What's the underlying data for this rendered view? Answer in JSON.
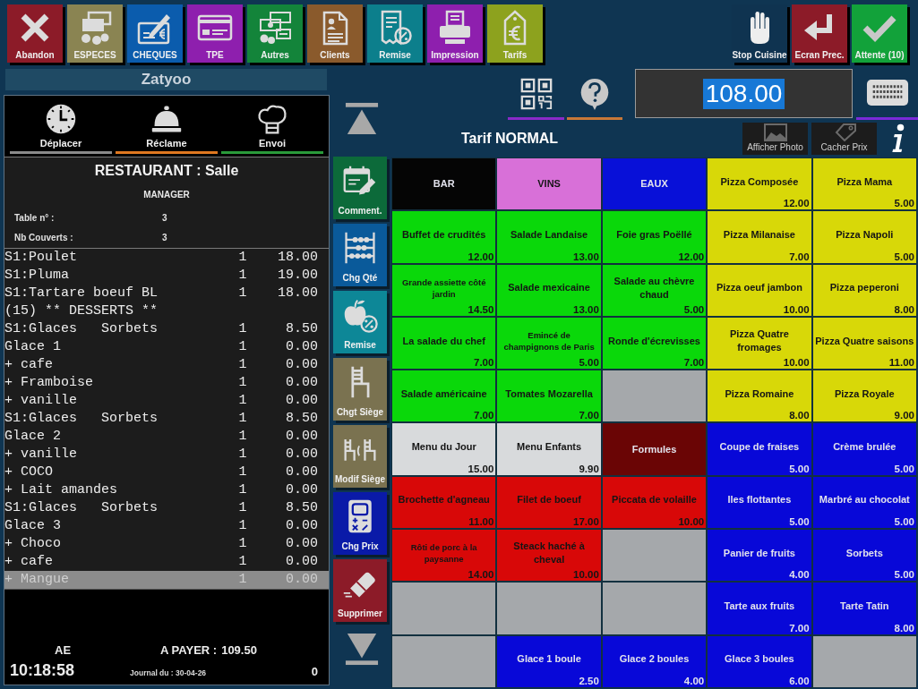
{
  "toolbar": {
    "buttons": [
      {
        "label": "Abandon",
        "color": "#8c1b28"
      },
      {
        "label": "ESPECES",
        "color": "#8a8452"
      },
      {
        "label": "CHEQUES",
        "color": "#0b5cad"
      },
      {
        "label": "TPE",
        "color": "#8e1fae"
      },
      {
        "label": "Autres",
        "color": "#13843a"
      },
      {
        "label": "Clients",
        "color": "#8a5a2c"
      },
      {
        "label": "Remise",
        "color": "#0c7f8c"
      },
      {
        "label": "Impression",
        "color": "#8e1fae"
      },
      {
        "label": "Tarifs",
        "color": "#8da21e"
      }
    ],
    "right_buttons": [
      {
        "label": "Stop Cuisine",
        "color": "#0f3350"
      },
      {
        "label": "Ecran Prec.",
        "color": "#8c1b28"
      },
      {
        "label": "Attente (10)",
        "color": "#12a23a"
      }
    ]
  },
  "ticket": {
    "title": "Zatyoo",
    "actions": [
      {
        "label": "Déplacer",
        "color": "#8a8a8a"
      },
      {
        "label": "Réclame",
        "color": "#e07820"
      },
      {
        "label": "Envoi",
        "color": "#2a9a3a"
      }
    ],
    "header": {
      "location": "RESTAURANT : Salle",
      "user": "MANAGER",
      "fields": [
        {
          "label": "Table n° :",
          "value": "3"
        },
        {
          "label": "Nb Couverts :",
          "value": "3"
        }
      ]
    },
    "lines": [
      {
        "name": "S1:Poulet",
        "qty": "1",
        "price": "18.00",
        "selected": false
      },
      {
        "name": "S1:Pluma",
        "qty": "1",
        "price": "19.00",
        "selected": false
      },
      {
        "name": "S1:Tartare boeuf BL",
        "qty": "1",
        "price": "18.00",
        "selected": false
      },
      {
        "name": "(15) ** DESSERTS **",
        "selected": false
      },
      {
        "name": "S1:Glaces   Sorbets",
        "qty": "1",
        "price": "8.50",
        "selected": false
      },
      {
        "name": "Glace 1",
        "qty": "1",
        "price": "0.00",
        "selected": false
      },
      {
        "name": "+ cafe",
        "qty": "1",
        "price": "0.00",
        "selected": false
      },
      {
        "name": "+ Framboise",
        "qty": "1",
        "price": "0.00",
        "selected": false
      },
      {
        "name": "+ vanille",
        "qty": "1",
        "price": "0.00",
        "selected": false
      },
      {
        "name": "S1:Glaces   Sorbets",
        "qty": "1",
        "price": "8.50",
        "selected": false
      },
      {
        "name": "Glace 2",
        "qty": "1",
        "price": "0.00",
        "selected": false
      },
      {
        "name": "+ vanille",
        "qty": "1",
        "price": "0.00",
        "selected": false
      },
      {
        "name": "+ COCO",
        "qty": "1",
        "price": "0.00",
        "selected": false
      },
      {
        "name": "+ Lait amandes",
        "qty": "1",
        "price": "0.00",
        "selected": false
      },
      {
        "name": "S1:Glaces   Sorbets",
        "qty": "1",
        "price": "8.50",
        "selected": false
      },
      {
        "name": "Glace 3",
        "qty": "1",
        "price": "0.00",
        "selected": false
      },
      {
        "name": "+ Choco",
        "qty": "1",
        "price": "0.00",
        "selected": false
      },
      {
        "name": "+ cafe",
        "qty": "1",
        "price": "0.00",
        "selected": false
      },
      {
        "name": "+ Mangue",
        "qty": "1",
        "price": "0.00",
        "selected": true
      }
    ],
    "footer": {
      "server": "AE",
      "amount_due": {
        "label": "A PAYER :",
        "value": "109.50"
      },
      "time": "10:18:58",
      "journal": "Journal du : 30-04-26",
      "counter": "0"
    }
  },
  "side_buttons": [
    {
      "label": "Comment.",
      "color": "#0c6a3a"
    },
    {
      "label": "Chg Qté",
      "color": "#0a5a9a"
    },
    {
      "label": "Remise",
      "color": "#0d8797"
    },
    {
      "label": "Chgt Siège",
      "color": "#7a7250"
    },
    {
      "label": "Modif Siège",
      "color": "#7a7250"
    },
    {
      "label": "Chg Prix",
      "color": "#0a1aa8"
    },
    {
      "label": "Supprimer",
      "color": "#8c1b28"
    }
  ],
  "display": {
    "value": "108.00",
    "selected": true
  },
  "tariff": "Tarif NORMAL",
  "view_buttons": [
    {
      "label": "Afficher Photo"
    },
    {
      "label": "Cacher Prix"
    }
  ],
  "product_grid": {
    "cells": [
      {
        "kind": "category",
        "label": "BAR",
        "color": "#050505"
      },
      {
        "kind": "category",
        "label": "VINS",
        "color": "#d870d8"
      },
      {
        "kind": "category",
        "label": "EAUX",
        "color": "#0810d8"
      },
      {
        "kind": "product",
        "label": "Pizza Composée",
        "price": "12.00",
        "color": "#d8d808"
      },
      {
        "kind": "product",
        "label": "Pizza Mama",
        "price": "5.00",
        "color": "#d8d808"
      },
      {
        "kind": "product",
        "label": "Buffet de crudités",
        "price": "12.00",
        "color": "#0ad80a"
      },
      {
        "kind": "product",
        "label": "Salade Landaise",
        "price": "13.00",
        "color": "#0ad80a"
      },
      {
        "kind": "product",
        "label": "Foie gras Poëllé",
        "price": "12.00",
        "color": "#0ad80a"
      },
      {
        "kind": "product",
        "label": "Pizza Milanaise",
        "price": "7.00",
        "color": "#d8d808"
      },
      {
        "kind": "product",
        "label": "Pizza Napoli",
        "price": "5.00",
        "color": "#d8d808"
      },
      {
        "kind": "product",
        "label": "Grande assiette côté jardin",
        "price": "14.50",
        "color": "#0ad80a"
      },
      {
        "kind": "product",
        "label": "Salade mexicaine",
        "price": "13.00",
        "color": "#0ad80a"
      },
      {
        "kind": "product",
        "label": "Salade au chèvre chaud",
        "price": "5.00",
        "color": "#0ad80a"
      },
      {
        "kind": "product",
        "label": "Pizza oeuf jambon",
        "price": "10.00",
        "color": "#d8d808"
      },
      {
        "kind": "product",
        "label": "Pizza peperoni",
        "price": "8.00",
        "color": "#d8d808"
      },
      {
        "kind": "product",
        "label": "La salade du chef",
        "price": "7.00",
        "color": "#0ad80a"
      },
      {
        "kind": "product",
        "label": "Emincé de champignons de Paris",
        "price": "5.00",
        "color": "#0ad80a"
      },
      {
        "kind": "product",
        "label": "Ronde d'écrevisses",
        "price": "7.00",
        "color": "#0ad80a"
      },
      {
        "kind": "product",
        "label": "Pizza Quatre fromages",
        "price": "10.00",
        "color": "#d8d808"
      },
      {
        "kind": "product",
        "label": "Pizza Quatre saisons",
        "price": "11.00",
        "color": "#d8d808"
      },
      {
        "kind": "product",
        "label": "Salade américaine",
        "price": "7.00",
        "color": "#0ad80a"
      },
      {
        "kind": "product",
        "label": "Tomates Mozarella",
        "price": "7.00",
        "color": "#0ad80a"
      },
      {
        "kind": "empty"
      },
      {
        "kind": "product",
        "label": "Pizza Romaine",
        "price": "8.00",
        "color": "#d8d808"
      },
      {
        "kind": "product",
        "label": "Pizza Royale",
        "price": "9.00",
        "color": "#d8d808"
      },
      {
        "kind": "product",
        "label": "Menu du Jour",
        "price": "15.00",
        "color": "#d8dadc"
      },
      {
        "kind": "product",
        "label": "Menu Enfants",
        "price": "9.90",
        "color": "#d8dadc"
      },
      {
        "kind": "category",
        "label": "Formules",
        "color": "#6a0505"
      },
      {
        "kind": "product",
        "label": "Coupe de fraises",
        "price": "5.00",
        "color": "#0808d8"
      },
      {
        "kind": "product",
        "label": "Crème brulée",
        "price": "5.00",
        "color": "#0808d8"
      },
      {
        "kind": "product",
        "label": "Brochette d'agneau",
        "price": "11.00",
        "color": "#d80808"
      },
      {
        "kind": "product",
        "label": "Filet de boeuf",
        "price": "17.00",
        "color": "#d80808"
      },
      {
        "kind": "product",
        "label": "Piccata de volaille",
        "price": "10.00",
        "color": "#d80808"
      },
      {
        "kind": "product",
        "label": "Iles flottantes",
        "price": "5.00",
        "color": "#0808d8"
      },
      {
        "kind": "product",
        "label": "Marbré au chocolat",
        "price": "5.00",
        "color": "#0808d8"
      },
      {
        "kind": "product",
        "label": "Rôti de porc à la paysanne",
        "price": "14.00",
        "color": "#d80808"
      },
      {
        "kind": "product",
        "label": "Steack haché à cheval",
        "price": "10.00",
        "color": "#d80808"
      },
      {
        "kind": "empty"
      },
      {
        "kind": "product",
        "label": "Panier de fruits",
        "price": "4.00",
        "color": "#0808d8"
      },
      {
        "kind": "product",
        "label": "Sorbets",
        "price": "5.00",
        "color": "#0808d8"
      },
      {
        "kind": "empty"
      },
      {
        "kind": "empty"
      },
      {
        "kind": "empty"
      },
      {
        "kind": "product",
        "label": "Tarte aux fruits",
        "price": "7.00",
        "color": "#0808d8"
      },
      {
        "kind": "product",
        "label": "Tarte Tatin",
        "price": "8.00",
        "color": "#0808d8"
      },
      {
        "kind": "empty"
      },
      {
        "kind": "product",
        "label": "Glace 1 boule",
        "price": "2.50",
        "color": "#0808d8"
      },
      {
        "kind": "product",
        "label": "Glace 2 boules",
        "price": "4.00",
        "color": "#0808d8"
      },
      {
        "kind": "product",
        "label": "Glace 3 boules",
        "price": "6.00",
        "color": "#0808d8"
      },
      {
        "kind": "empty"
      }
    ]
  }
}
